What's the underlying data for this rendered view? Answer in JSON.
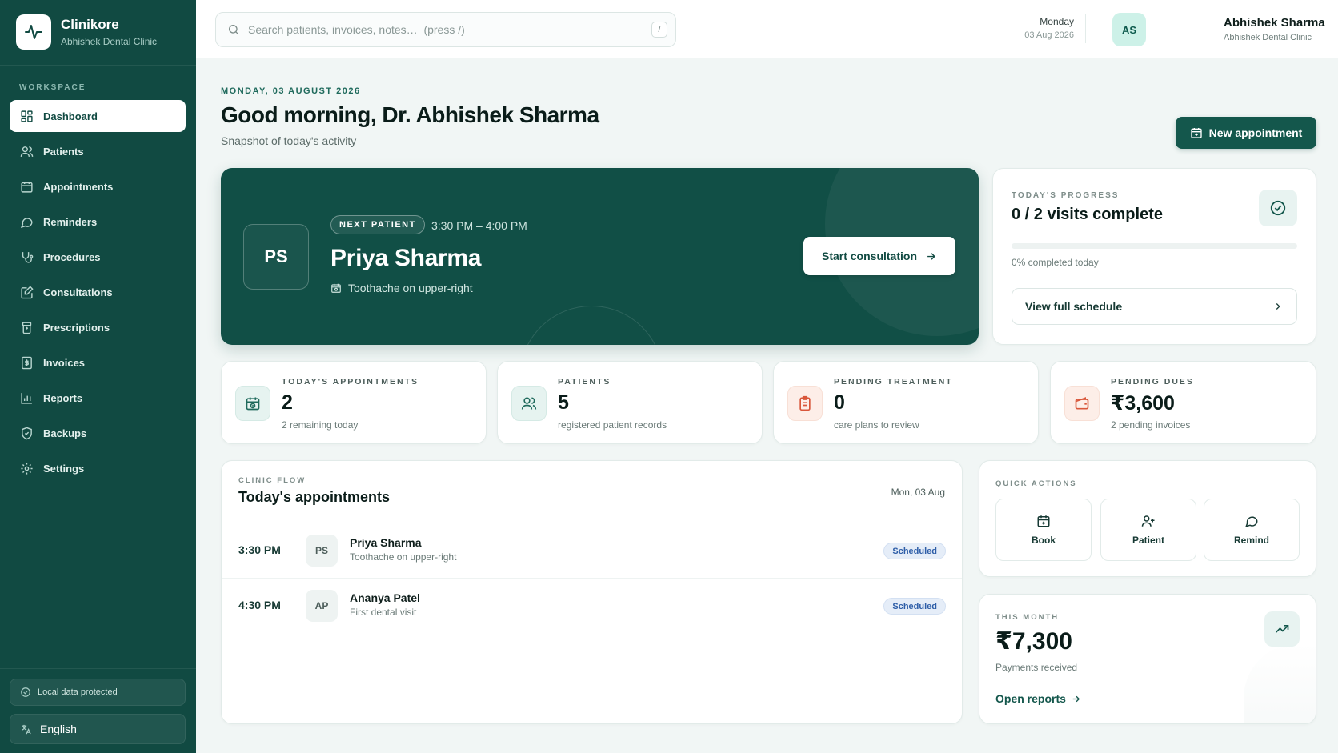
{
  "brand": {
    "name": "Clinikore",
    "clinic": "Abhishek Dental Clinic"
  },
  "sidebar": {
    "section_label": "WORKSPACE",
    "items": [
      {
        "label": "Dashboard",
        "icon": "grid-icon",
        "active": true
      },
      {
        "label": "Patients",
        "icon": "users-icon"
      },
      {
        "label": "Appointments",
        "icon": "calendar-icon"
      },
      {
        "label": "Reminders",
        "icon": "chat-bubble-icon"
      },
      {
        "label": "Procedures",
        "icon": "stethoscope-icon"
      },
      {
        "label": "Consultations",
        "icon": "clipboard-edit-icon"
      },
      {
        "label": "Prescriptions",
        "icon": "prescription-icon"
      },
      {
        "label": "Invoices",
        "icon": "invoice-icon"
      },
      {
        "label": "Reports",
        "icon": "bar-chart-icon"
      },
      {
        "label": "Backups",
        "icon": "shield-icon"
      },
      {
        "label": "Settings",
        "icon": "gear-icon"
      }
    ],
    "local_data": "Local data protected",
    "language": "English"
  },
  "topbar": {
    "search_placeholder": "Search patients, invoices, notes…  (press /)",
    "search_shortcut": "/",
    "day": "Monday",
    "date": "03 Aug 2026",
    "user_initials": "AS",
    "user_name": "Abhishek Sharma",
    "user_clinic": "Abhishek Dental Clinic"
  },
  "header": {
    "date_eyebrow": "MONDAY, 03 AUGUST 2026",
    "greeting": "Good morning, Dr. Abhishek Sharma",
    "subtitle": "Snapshot of today's activity",
    "new_appointment": "New appointment"
  },
  "next_patient": {
    "badge": "NEXT PATIENT",
    "time": "3:30 PM – 4:00 PM",
    "initials": "PS",
    "name": "Priya Sharma",
    "note": "Toothache on upper-right",
    "start_label": "Start consultation"
  },
  "progress": {
    "eyebrow": "TODAY'S PROGRESS",
    "title": "0 / 2 visits complete",
    "percent": 0,
    "percent_text": "0% completed today",
    "schedule_label": "View full schedule"
  },
  "stats": [
    {
      "label": "TODAY'S APPOINTMENTS",
      "value": "2",
      "sub": "2 remaining today",
      "icon": "calendar-clock-icon",
      "tone": "teal"
    },
    {
      "label": "PATIENTS",
      "value": "5",
      "sub": "registered patient records",
      "icon": "users-icon",
      "tone": "teal"
    },
    {
      "label": "PENDING TREATMENT",
      "value": "0",
      "sub": "care plans to review",
      "icon": "clipboard-icon",
      "tone": "peach"
    },
    {
      "label": "PENDING DUES",
      "value": "₹3,600",
      "sub": "2 pending invoices",
      "icon": "wallet-icon",
      "tone": "peach"
    }
  ],
  "appointments": {
    "eyebrow": "CLINIC FLOW",
    "title": "Today's appointments",
    "date": "Mon, 03 Aug",
    "rows": [
      {
        "time": "3:30 PM",
        "initials": "PS",
        "name": "Priya Sharma",
        "note": "Toothache on upper-right",
        "status": "Scheduled"
      },
      {
        "time": "4:30 PM",
        "initials": "AP",
        "name": "Ananya Patel",
        "note": "First dental visit",
        "status": "Scheduled"
      }
    ]
  },
  "quick_actions": {
    "eyebrow": "QUICK ACTIONS",
    "items": [
      {
        "label": "Book",
        "icon": "calendar-plus-icon"
      },
      {
        "label": "Patient",
        "icon": "user-plus-icon"
      },
      {
        "label": "Remind",
        "icon": "chat-bubble-icon"
      }
    ]
  },
  "month": {
    "eyebrow": "THIS MONTH",
    "value": "₹7,300",
    "sub": "Payments received",
    "link": "Open reports"
  },
  "colors": {
    "sidebar_bg": "#114a42",
    "accent": "#14574c",
    "hero_bg": "#114f46",
    "badge_blue": "#2e5ea8",
    "peach_icon": "#d9573b"
  }
}
